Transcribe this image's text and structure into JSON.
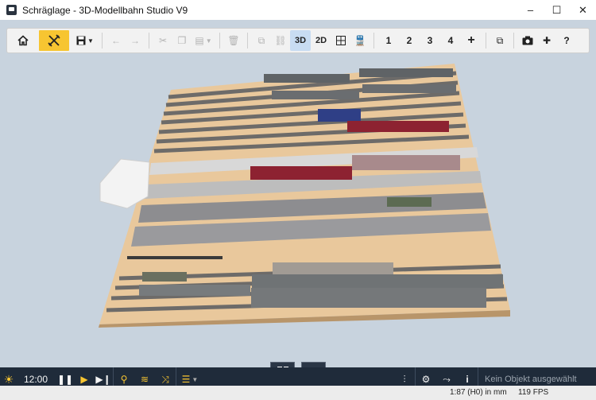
{
  "window": {
    "title": "Schräglage - 3D-Modellbahn Studio V9",
    "controls": [
      "–",
      "☐",
      "✕"
    ]
  },
  "toolbar": {
    "view_3d": "3D",
    "view_2d": "2D",
    "view_numbers": [
      "1",
      "2",
      "3",
      "4"
    ],
    "add_view": "+",
    "help": "?"
  },
  "bottombar": {
    "time": "12:00",
    "status_text": "Kein Objekt ausgewählt"
  },
  "statusbar": {
    "scale": "1:87 (H0) in mm",
    "fps": "119 FPS"
  },
  "colors": {
    "toolbar_accent": "#f7c531",
    "active_view": "#c8dcf2",
    "bottom_bar": "#1f2b3a",
    "ground": "#e9c89c"
  }
}
